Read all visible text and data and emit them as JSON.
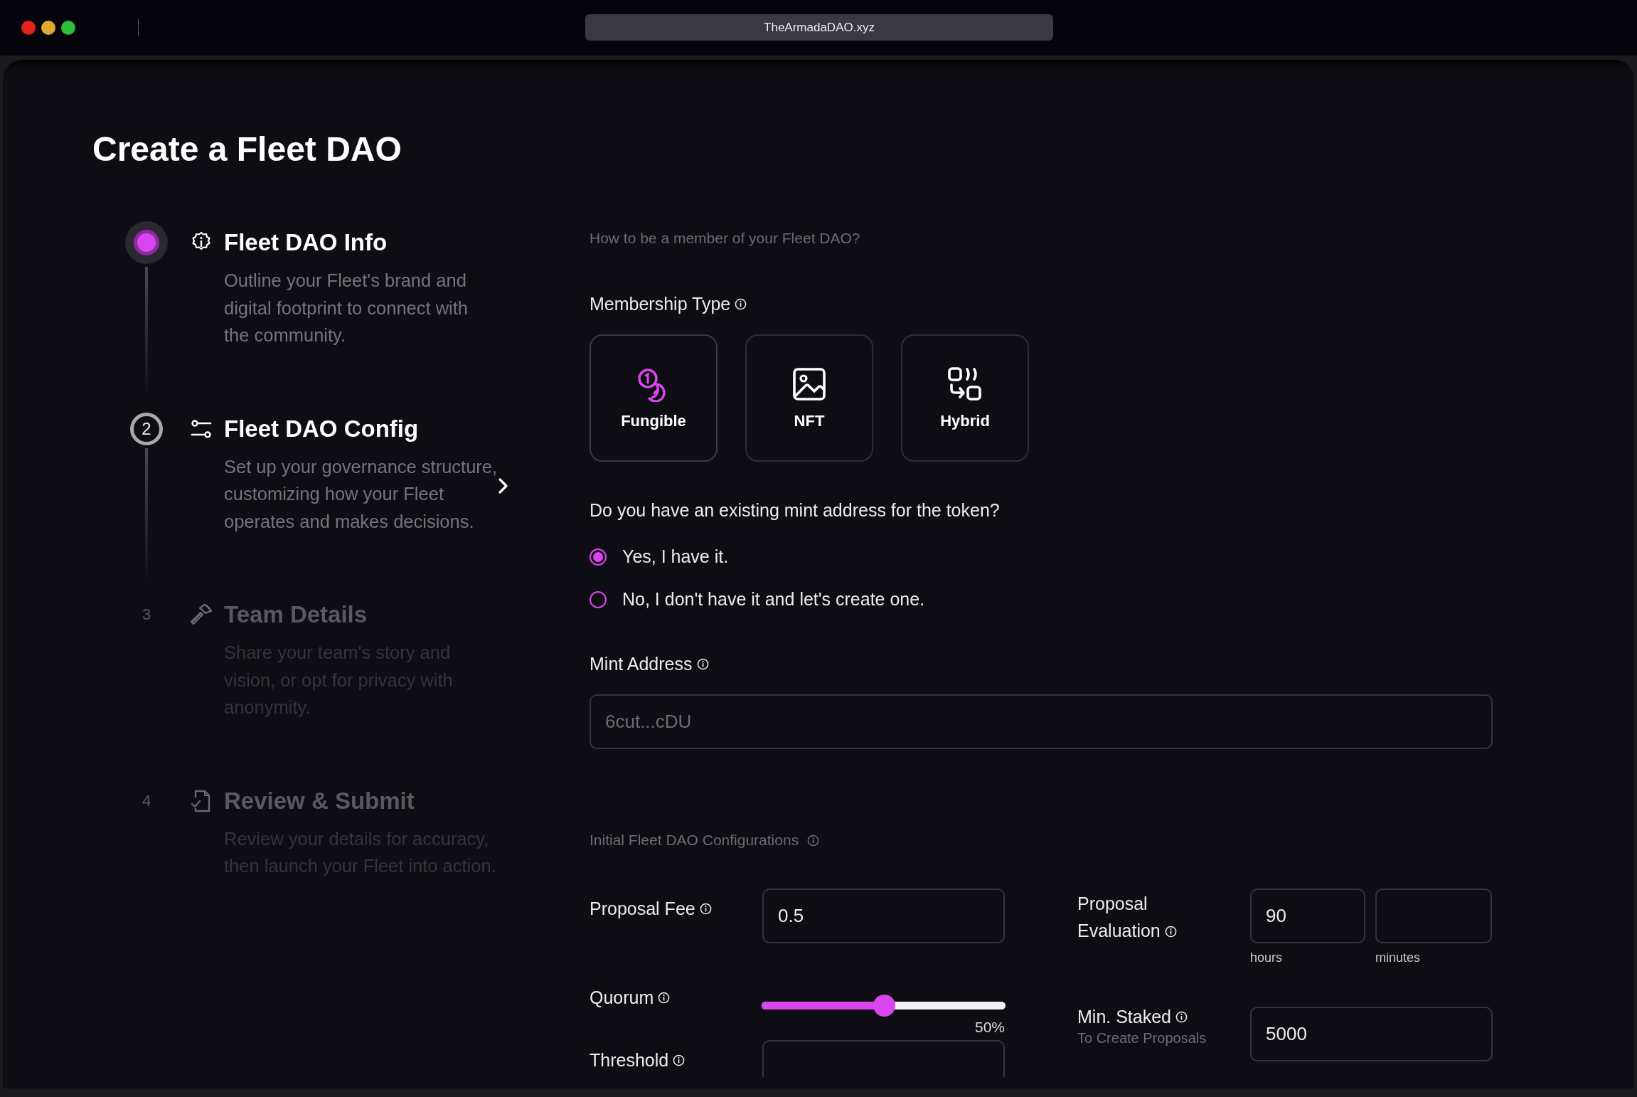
{
  "browser": {
    "url": "TheArmadaDAO.xyz"
  },
  "page": {
    "title": "Create a Fleet DAO"
  },
  "steps": [
    {
      "title": "Fleet DAO Info",
      "description": "Outline your Fleet's brand and digital footprint to connect with the community.",
      "done": true,
      "current": false,
      "kind": "info",
      "selected": false
    },
    {
      "number": "2",
      "title": "Fleet DAO Config",
      "description": "Set up your governance structure, customizing how your Fleet operates and makes decisions.",
      "done": false,
      "current": true,
      "kind": "sliders",
      "selected": true
    },
    {
      "number": "3",
      "title": "Team Details",
      "description": "Share your team's story and vision, or opt for privacy with anonymity.",
      "done": false,
      "current": false,
      "kind": "hammer",
      "selected": false
    },
    {
      "number": "4",
      "title": "Review & Submit",
      "description": "Review your details for accuracy, then launch your Fleet into action.",
      "done": false,
      "current": false,
      "kind": "document",
      "selected": false
    }
  ],
  "form": {
    "intro": "How to be a member of your Fleet DAO?",
    "membership": {
      "label": "Membership Type",
      "options": [
        {
          "label": "Fungible",
          "kind": "coins",
          "selected": true
        },
        {
          "label": "NFT",
          "kind": "image",
          "selected": false
        },
        {
          "label": "Hybrid",
          "kind": "hybrid",
          "selected": false
        }
      ]
    },
    "mint_question": {
      "question": "Do you have an existing mint address for the token?",
      "options": [
        {
          "label": "Yes, I have it.",
          "selected": true
        },
        {
          "label": "No, I don't have it and let's create one.",
          "selected": false
        }
      ]
    },
    "mint_address": {
      "label": "Mint Address",
      "placeholder": "6cut...cDU"
    },
    "config": {
      "title": "Initial Fleet DAO Configurations",
      "proposal_fee": {
        "label": "Proposal Fee",
        "value": "0.5"
      },
      "quorum": {
        "label": "Quorum",
        "level": 0.5,
        "reading": "50%"
      },
      "threshold": {
        "label": "Threshold"
      },
      "proposal_evaluation": {
        "label": "Proposal Evaluation",
        "hours": "90",
        "hours_unit": "hours",
        "minutes_unit": "minutes"
      },
      "min_staked": {
        "label": "Min. Staked",
        "note": "To Create Proposals",
        "value": "5000"
      }
    }
  }
}
